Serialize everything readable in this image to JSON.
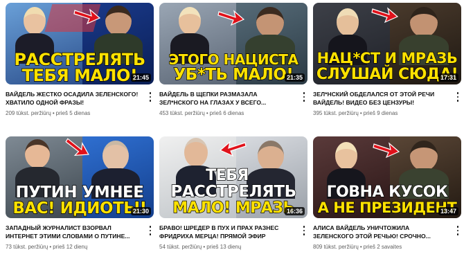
{
  "videos": [
    {
      "caption_top": "РАССТРЕЛЯТЬ",
      "caption_bottom": "ТЕБЯ МАЛО!",
      "duration": "21:45",
      "title": "ВАЙДЕЛЬ ЖЕСТКО ОСАДИЛА ЗЕЛЕНСКОГО! ХВАТИЛО ОДНОЙ ФРАЗЫ!",
      "views": "209 tūkst. peržiūrų",
      "age": "prieš 5 dienas"
    },
    {
      "caption_top": "ЭТОГО НАЦИСТА",
      "caption_bottom": "УБ*ТЬ МАЛО!",
      "duration": "21:35",
      "title": "ВАЙДЕЛЬ В ЩЕПКИ РАЗМАЗАЛА ЗЕЛ*НСКОГО НА ГЛАЗАХ У ВСЕГО...",
      "views": "453 tūkst. peržiūrų",
      "age": "prieš 6 dienas"
    },
    {
      "caption_top": "НАЦ*СТ И МРАЗЬ",
      "caption_bottom": "СЛУШАЙ СЮДА!",
      "duration": "17:31",
      "title": "ЗЕЛ*НСКИЙ ОБДЕЛАЛСЯ ОТ ЭТОЙ РЕЧИ ВАЙДЕЛЬ! ВИДЕО БЕЗ ЦЕНЗУРЫ!",
      "views": "395 tūkst. peržiūrų",
      "age": "prieš 9 dienas"
    },
    {
      "caption_top": "ПУТИН УМНЕЕ",
      "caption_bottom": "ВАС! ИДИОТЫ!",
      "duration": "21:30",
      "title": "ЗАПАДНЫЙ ЖУРНАЛИСТ ВЗОРВАЛ ИНТЕРНЕТ ЭТИМИ СЛОВАМИ О ПУТИНЕ...",
      "views": "73 tūkst. peržiūrų",
      "age": "prieš 12 dienų"
    },
    {
      "caption_top": "ТЕБЯ",
      "caption_mid": "РАССТРЕЛЯТЬ",
      "caption_bottom": "МАЛО! МРАЗЬ",
      "duration": "16:36",
      "title": "БРАВО! ШРЕДЕР В ПУХ И ПРАХ РАЗНЕС ФРИДРИХА МЕРЦА! ПРЯМОЙ ЭФИР",
      "views": "54 tūkst. peržiūrų",
      "age": "prieš 13 dienų"
    },
    {
      "caption_top": "ГОВНА КУСОК",
      "caption_bottom": "А НЕ ПРЕЗИДЕНТ",
      "duration": "13:47",
      "title": "АЛИСА ВАЙДЕЛЬ УНИЧТОЖИЛА ЗЕЛЕНСКОГО ЭТОЙ РЕЧЬЮ! СРОЧНО...",
      "views": "809 tūkst. peržiūrų",
      "age": "prieš 2 savaites"
    }
  ],
  "more_icon": "more-vert-icon",
  "colors": {
    "caption_yellow": "#ffe200",
    "arrow_red": "#e0121b"
  }
}
